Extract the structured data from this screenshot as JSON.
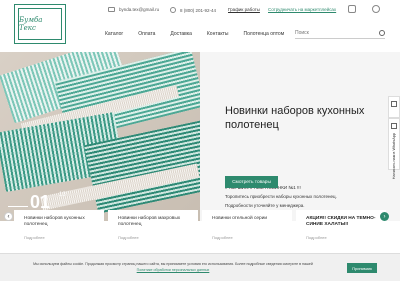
{
  "brand": {
    "logo_text": "Бумба Текс"
  },
  "topbar": {
    "email": "bynda.tex@gmail.ru",
    "phone": "8 (800) 201-92-44",
    "schedule_link": "График работы",
    "partner_link": "Сотрудничать на маркетплейсах"
  },
  "nav": {
    "items": [
      "Каталог",
      "Оплата",
      "Доставка",
      "Контакты",
      "Полотенца оптом"
    ]
  },
  "search": {
    "placeholder": "Поиск"
  },
  "hero": {
    "title": "Новинки наборов кухонных полотенец",
    "text_lines": [
      "Уважаемые покупатели!",
      "У нас ШИКАРНЫЕ НОВИНКИ №1 !!!",
      "Торопитесь приобрести наборы кухонных полотенец.",
      "Подробности уточняйте у менеджера."
    ],
    "button": "Смотреть товары",
    "slide_current": "01",
    "slide_total": "13"
  },
  "side_tabs": {
    "tab2_label": "Написать нам в WhatsApp"
  },
  "cards": [
    {
      "title": "Новинки наборов кухонных полотенец",
      "more": "Подробнее"
    },
    {
      "title": "Новинки наборов махровых полотенец",
      "more": "Подробнее"
    },
    {
      "title": "Новинки отельной серии",
      "more": "Подробнее"
    },
    {
      "title": "АКЦИЯ!! СКИДКИ НА ТЕМНО-СИНИЕ ХАЛАТЫ!!",
      "more": "Подробнее"
    }
  ],
  "cookie": {
    "text": "Мы используем файлы cookie. Продолжая просмотр страниц нашего сайта, вы принимаете условия его использования. Более подробные сведения смотрите в нашей",
    "link": "Политике обработки персональных данных",
    "button": "Принимаю"
  },
  "colors": {
    "accent": "#2e8a6e"
  }
}
